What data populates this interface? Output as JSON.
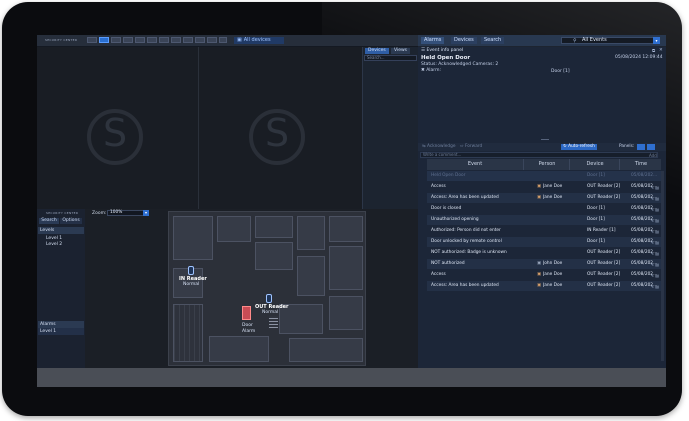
{
  "top": {
    "logo": "SECURITY CENTER",
    "layout_selector_label": "All devices"
  },
  "right_top": {
    "tabs": [
      "Alarms",
      "Devices",
      "Search"
    ],
    "search_value": "All Events"
  },
  "device_panel": {
    "tabs": [
      "Devices",
      "Views"
    ],
    "search_placeholder": "Search..."
  },
  "event_info": {
    "panel_title": "Event info panel",
    "event_name": "Held Open Door",
    "event_time": "05/08/2024 12:09:44",
    "status_line": "Status: Acknowledged Cameras: 2",
    "alarm_label": "Alarm:",
    "alarm_value": "Door [1]"
  },
  "event_toolbar": {
    "acknowledge": "Acknowledge",
    "forward": "Forward",
    "comment_placeholder": "Write a comment...",
    "add": "Add",
    "auto_refresh": "Auto-refresh",
    "panels_label": "Panels:"
  },
  "events_table": {
    "columns": [
      "Event",
      "Person",
      "Device",
      "Time"
    ],
    "rows": [
      {
        "event": "Held Open Door",
        "person": "",
        "device": "Door [1]",
        "time": "05/08/202...",
        "highlight": true
      },
      {
        "event": "Access",
        "person": "Jane Doe",
        "device": "OUT Reader [2]",
        "time": "05/08/202..."
      },
      {
        "event": "Access: Area has been updated",
        "person": "Jane Doe",
        "device": "OUT Reader [2]",
        "time": "05/08/202..."
      },
      {
        "event": "Door is closed",
        "person": "",
        "device": "Door [1]",
        "time": "05/08/202..."
      },
      {
        "event": "Unauthorized opening",
        "person": "",
        "device": "Door [1]",
        "time": "05/08/202..."
      },
      {
        "event": "Authorized: Person did not enter",
        "person": "",
        "device": "IN Reader [1]",
        "time": "05/08/202..."
      },
      {
        "event": "Door unlocked by remote control",
        "person": "",
        "device": "Door [1]",
        "time": "05/08/202..."
      },
      {
        "event": "NOT authorized: Badge is unknown",
        "person": "",
        "device": "OUT Reader [2]",
        "time": "05/08/202..."
      },
      {
        "event": "NOT authorized",
        "person": "John Doe",
        "device": "OUT Reader [2]",
        "time": "05/08/202..."
      },
      {
        "event": "Access",
        "person": "Jane Doe",
        "device": "OUT Reader [2]",
        "time": "05/08/202..."
      },
      {
        "event": "Access: Area has been updated",
        "person": "Jane Doe",
        "device": "OUT Reader [2]",
        "time": "05/08/202..."
      }
    ]
  },
  "map_side": {
    "logo": "SECURITY CENTER",
    "tabs": [
      "Search",
      "Options"
    ],
    "levels_title": "Levels",
    "levels": [
      "Level 1",
      "Level 2"
    ],
    "alarms_title": "Alarms",
    "alarms_items": [
      "Level 1"
    ]
  },
  "map": {
    "zoom_label": "Zoom:",
    "zoom_value": "100%",
    "in_reader": {
      "name": "IN Reader",
      "status": "Normal"
    },
    "out_reader": {
      "name": "OUT Reader",
      "status": "Normal"
    },
    "door": {
      "name": "Door",
      "status": "Alarm"
    }
  },
  "colors": {
    "accent": "#2a6fd0",
    "alarm": "#d05a5a"
  }
}
